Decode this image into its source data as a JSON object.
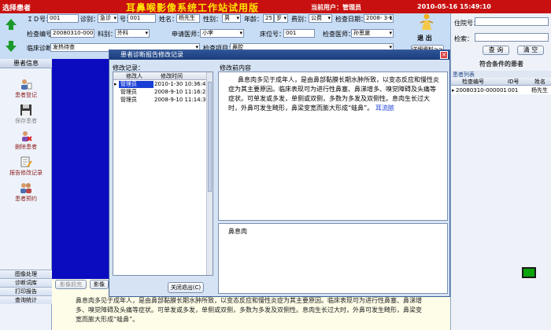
{
  "app": {
    "panel_title": "选择患者",
    "title": "耳鼻喉影像系统工作站试用版",
    "current_user": "当前用户：管理员",
    "datetime": "2010-05-16 15:49:10"
  },
  "header": {
    "fields": {
      "id_label": "ＩＤ号：",
      "id_value": "001",
      "visit_label": "诊别：",
      "visit_value": "急诊",
      "no_label": "号：",
      "no_value": "001",
      "name_label": "姓名：",
      "name_value": "杨先生",
      "gender_label": "性别：",
      "gender_value": "男",
      "age_label": "年龄：",
      "age_value": "25",
      "age_unit": "岁",
      "fee_label": "费别：",
      "fee_value": "公费",
      "date_label": "检查日期：",
      "date_value": "2008- 3-10",
      "exam_no_label": "检查编号：",
      "exam_no_value": "20080310-000001",
      "dept_label": "科别：",
      "dept_value": "外科",
      "doctor_label": "申请医师：",
      "doctor_value": "小李",
      "bed_label": "床位号：",
      "bed_value": "001",
      "exam_doctor_label": "检查医师：",
      "exam_doctor_value": "孙思邈",
      "diagnosis_label": "临床诊断：",
      "diagnosis_value": "发热待查",
      "item_label": "检查项目：",
      "item_value": "鼻腔"
    },
    "exit_label": "退  出",
    "detail_label": "详细资料>>"
  },
  "left_panel": {
    "header": "患者信息",
    "items": [
      "患者登记",
      "保存患者",
      "删除患者",
      "报告修改记录",
      "患者预约"
    ],
    "bottom": [
      "图像处理",
      "诊断词库",
      "打印报告",
      "查询统计"
    ]
  },
  "right_panel": {
    "hospital_label": "住院号：",
    "search_label": "检索：",
    "query_button": "查 询",
    "clear_button": "清 空",
    "result_title": "符合条件的患者",
    "list_title": "患者列表",
    "columns": [
      "检查编号",
      "ID号",
      "姓名"
    ],
    "rows": [
      [
        "20080310-000001",
        "001",
        "杨先生"
      ]
    ]
  },
  "dialog": {
    "title": "患者诊断报告修改记录",
    "records_label": "修改记录：",
    "records_columns": [
      "修改人",
      "修改时间"
    ],
    "records": [
      [
        "管理员",
        "2010-1-30 10:36:41"
      ],
      [
        "管理员",
        "2008-9-10 11:16:27"
      ],
      [
        "管理员",
        "2008-9-10 11:14:36"
      ]
    ],
    "content_label": "修改前内容",
    "content_text": "鼻息肉多见于成年人，是由鼻部黏膜长期水肿所致，以变态反应和慢性炎症为其主要原因。临床表现可为进行性鼻塞、鼻涕增多、嗅觉障碍及头痛等症状。可单发或多发，单侧或双侧，多数为多发及双侧性。息肉生长过大时，外鼻可发生畸形，鼻梁变宽而膨大形成“蛙鼻”。",
    "content_link": "耳流脓",
    "after_text": "鼻息肉",
    "close_button": "关闭退出(C)"
  },
  "workspace": {
    "btn_left": "影像抓完",
    "btn_right": "影像",
    "doc_text": "鼻息肉多见于成年人，是由鼻部黏膜长期水肿所致，以变态反应和慢性炎症为其主要原因。临床表现可为进行性鼻塞、鼻涕增多、嗅觉障碍及头痛等症状。可单发或多发，单侧或双侧，多数为多发及双侧性。息肉生长过大时，外鼻可发生畸形，鼻梁变宽而膨大形成“蛙鼻”。"
  }
}
